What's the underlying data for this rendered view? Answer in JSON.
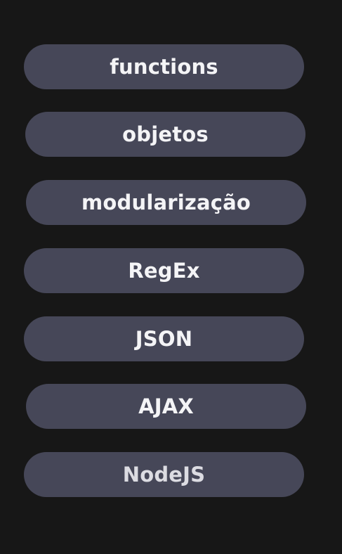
{
  "buttons": [
    {
      "label": "functions"
    },
    {
      "label": "objetos"
    },
    {
      "label": "modularização"
    },
    {
      "label": "RegEx"
    },
    {
      "label": "JSON"
    },
    {
      "label": "AJAX"
    },
    {
      "label": "NodeJS"
    }
  ]
}
